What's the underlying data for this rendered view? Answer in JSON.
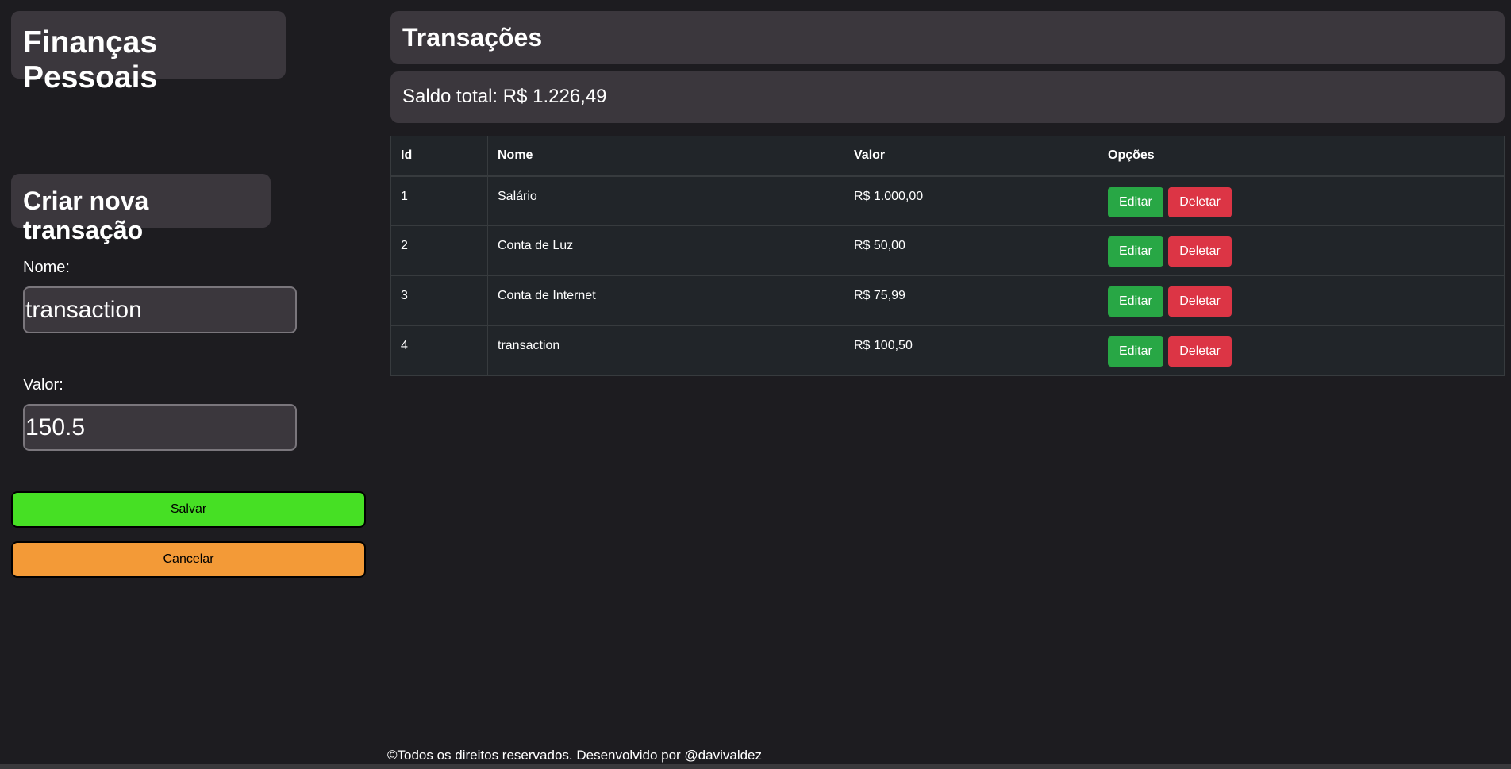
{
  "app": {
    "title": "Finanças Pessoais"
  },
  "form": {
    "title": "Criar nova transação",
    "name_label": "Nome:",
    "name_value": "transaction",
    "value_label": "Valor:",
    "value_value": "150.5",
    "save_label": "Salvar",
    "cancel_label": "Cancelar"
  },
  "transactions": {
    "title": "Transações",
    "balance": "Saldo total: R$ 1.226,49",
    "columns": [
      "Id",
      "Nome",
      "Valor",
      "Opções"
    ],
    "rows": [
      {
        "id": "1",
        "nome": "Salário",
        "valor": "R$ 1.000,00"
      },
      {
        "id": "2",
        "nome": "Conta de Luz",
        "valor": "R$ 50,00"
      },
      {
        "id": "3",
        "nome": "Conta de Internet",
        "valor": "R$ 75,99"
      },
      {
        "id": "4",
        "nome": "transaction",
        "valor": "R$ 100,50"
      }
    ],
    "edit_label": "Editar",
    "delete_label": "Deletar"
  },
  "footer": {
    "text": "©Todos os direitos reservados. Desenvolvido por @davivaldez"
  },
  "colors": {
    "background": "#1d1c20",
    "card": "#3b373d",
    "save": "#46e024",
    "cancel": "#f39a37",
    "edit": "#28a745",
    "delete": "#dc3545"
  }
}
